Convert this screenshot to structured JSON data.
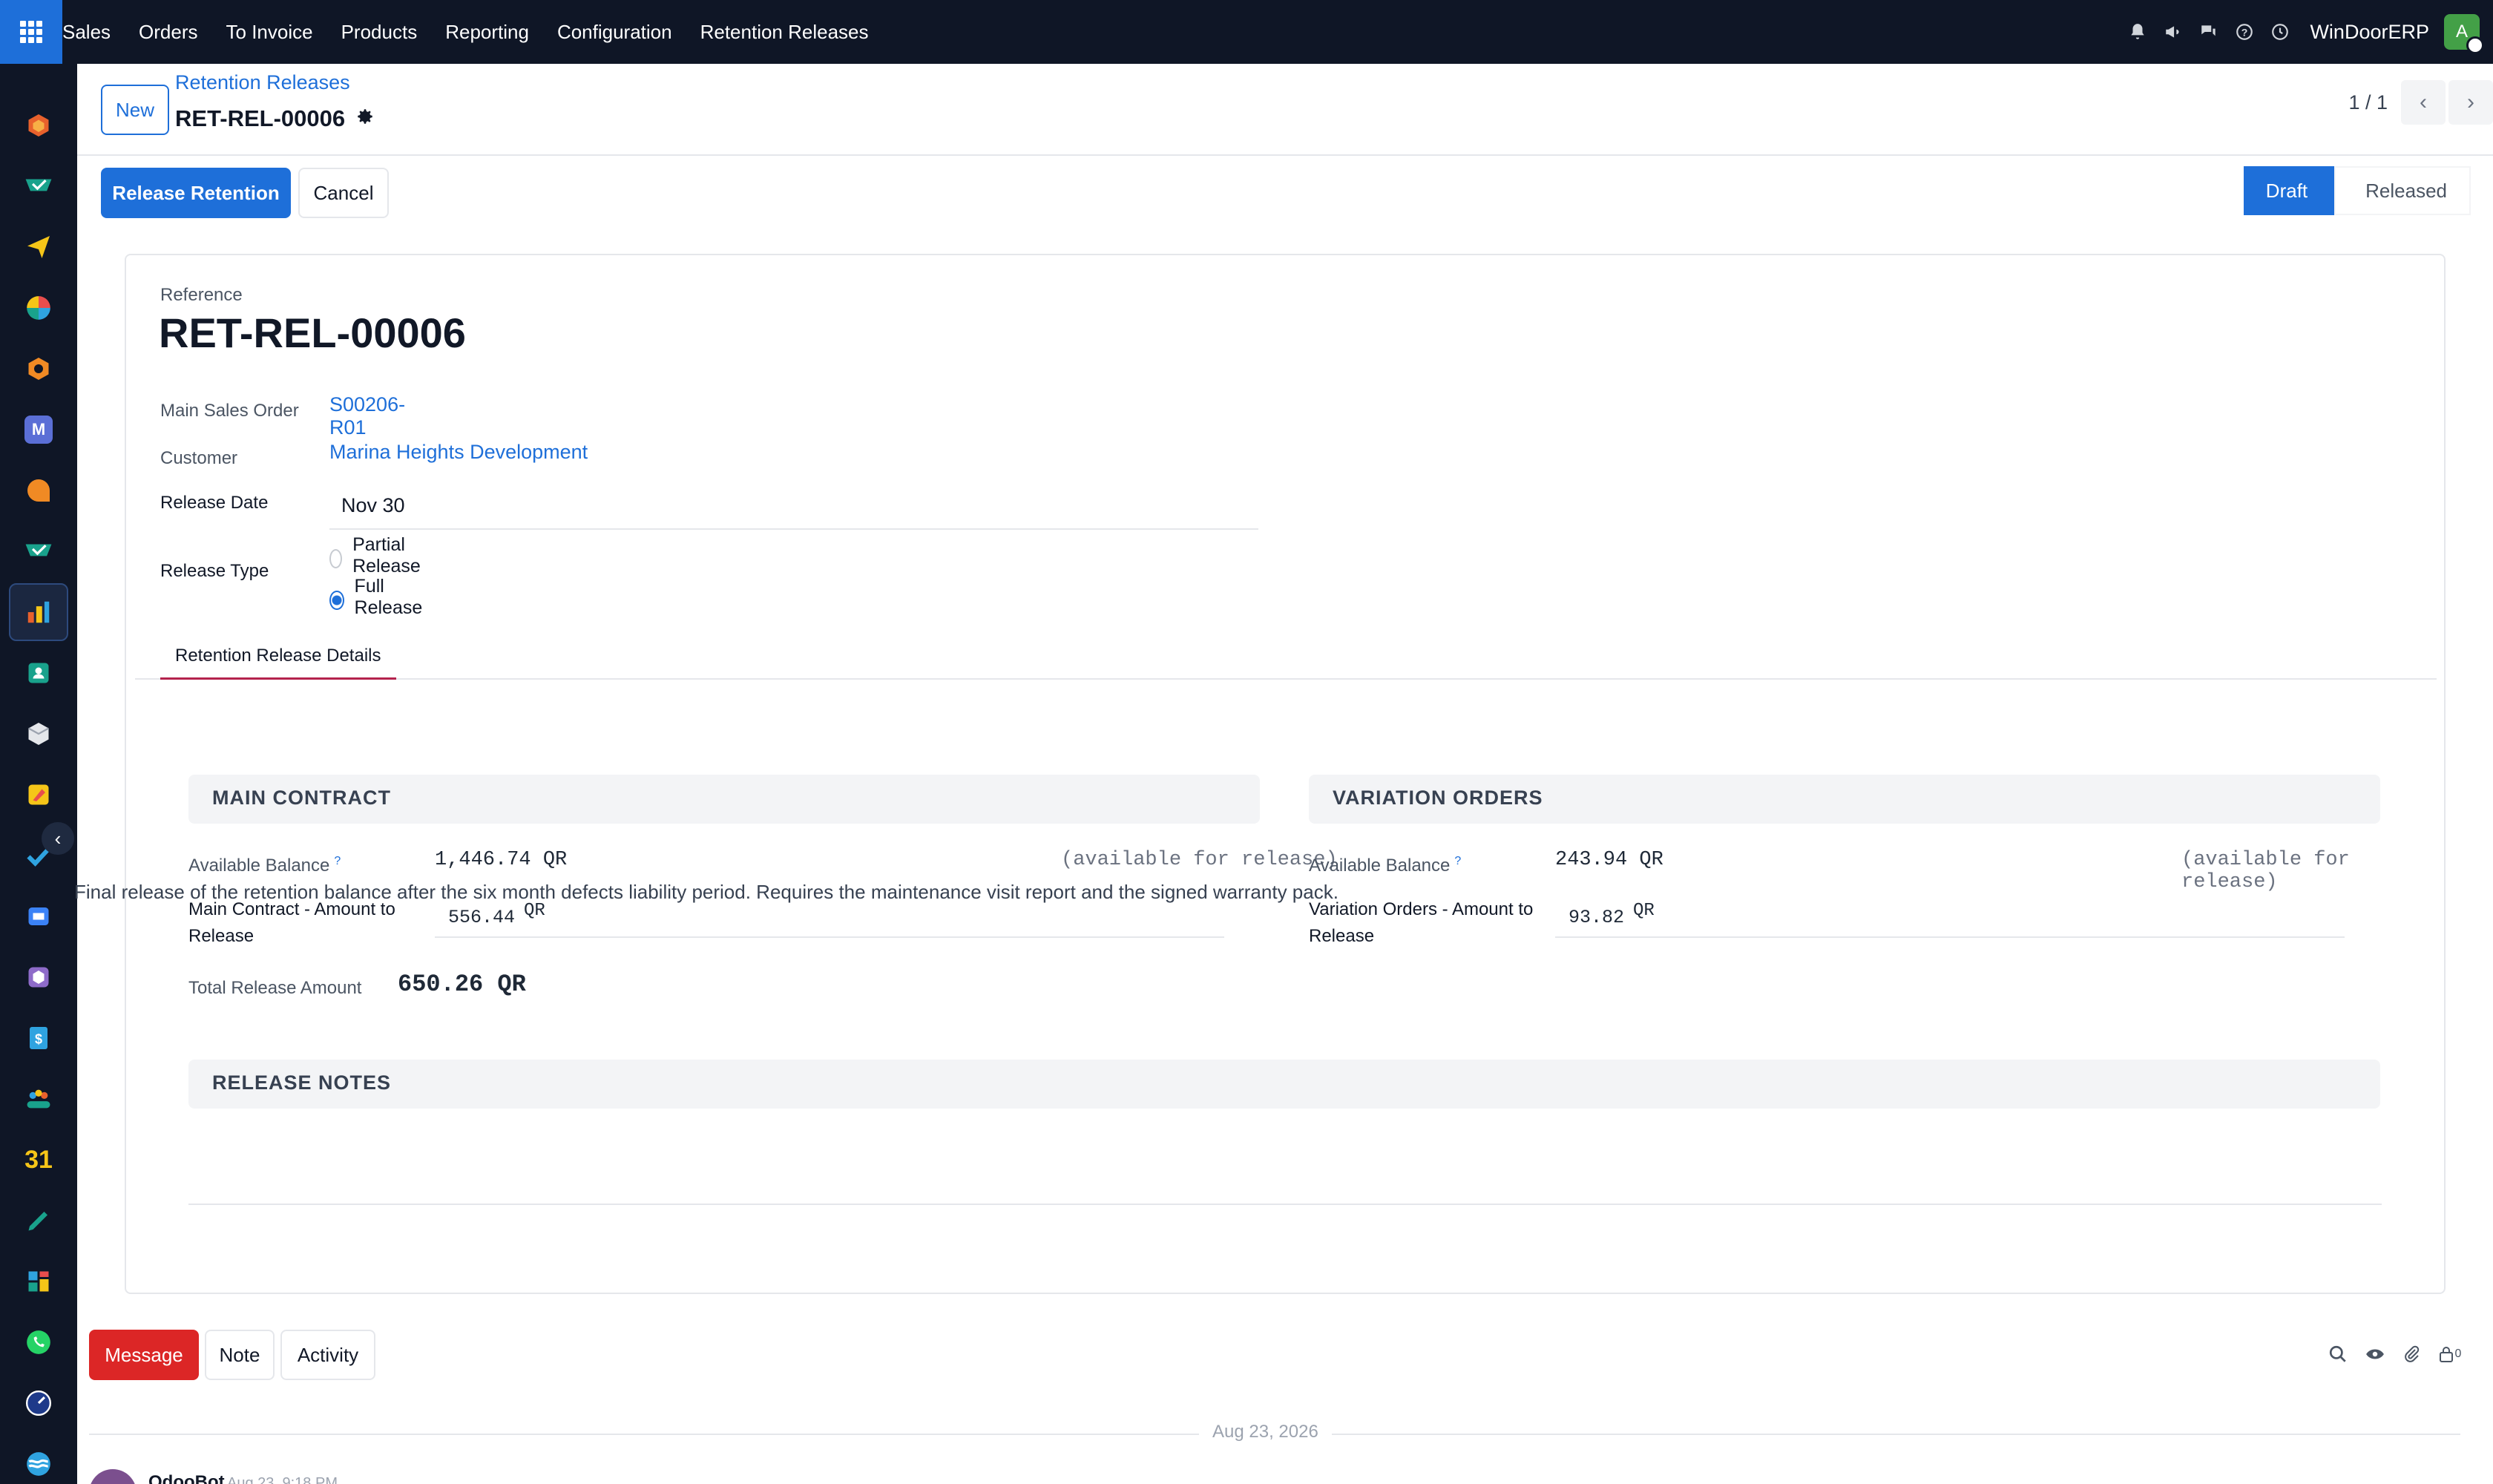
{
  "topnav": {
    "menu": [
      "Sales",
      "Orders",
      "To Invoice",
      "Products",
      "Reporting",
      "Configuration",
      "Retention Releases"
    ],
    "company": "WinDoorERP",
    "avatar_initial": "A"
  },
  "sidebar": {
    "icons": [
      "cube-icon",
      "check-tray-icon",
      "paper-plane-icon",
      "pie-chart-icon",
      "hexagon-icon",
      "mail-m-icon",
      "chat-bubble-icon",
      "check-tray-icon",
      "bar-chart-icon",
      "contact-card-icon",
      "box-icon",
      "brush-icon",
      "check-icon",
      "book-icon",
      "package-icon",
      "dollar-doc-icon",
      "team-icon",
      "calendar-31-icon",
      "pen-icon",
      "dashboard-icon",
      "whatsapp-icon",
      "gauge-icon",
      "waves-icon"
    ],
    "calendar_day": "31"
  },
  "control": {
    "new_label": "New",
    "breadcrumb": "Retention Releases",
    "record_name": "RET-REL-00006",
    "pager_value": "1 / 1"
  },
  "actions": {
    "release_label": "Release Retention",
    "cancel_label": "Cancel"
  },
  "statusbar": {
    "current": "Draft",
    "next": "Released"
  },
  "form": {
    "reference_label": "Reference",
    "reference": "RET-REL-00006",
    "main_sales_order_label": "Main Sales Order",
    "main_sales_order": "S00206-R01",
    "customer_label": "Customer",
    "customer": "Marina Heights Development",
    "release_date_label": "Release Date",
    "release_date": "Nov 30",
    "release_type_label": "Release Type",
    "release_type_options": [
      "Partial Release",
      "Full Release"
    ],
    "release_type_selected": "Full Release"
  },
  "tabs": {
    "details": "Retention Release Details"
  },
  "main_contract": {
    "header": "MAIN CONTRACT",
    "available_balance_label": "Available Balance",
    "help_mark": "?",
    "available_balance": "1,446.74 QR",
    "available_note": "(available for release)",
    "amount_label": "Main Contract - Amount to Release",
    "amount": "556.44",
    "currency": "QR",
    "total_label": "Total Release Amount",
    "total": "650.26 QR"
  },
  "variation_orders": {
    "header": "VARIATION ORDERS",
    "available_balance_label": "Available Balance",
    "help_mark": "?",
    "available_balance": "243.94 QR",
    "available_note": "(available for release)",
    "amount_label": "Variation Orders - Amount to Release",
    "amount": "93.82",
    "currency": "QR"
  },
  "release_notes": {
    "header": "RELEASE NOTES",
    "text": "Final release of the retention balance after the six month defects liability period. Requires the maintenance visit report and the signed warranty pack."
  },
  "chatter": {
    "message_label": "Message",
    "note_label": "Note",
    "activity_label": "Activity",
    "follower_count": "0",
    "date_separator": "Aug 23, 2026",
    "author": "OdooBot",
    "time": "Aug 23, 9:18 PM"
  }
}
